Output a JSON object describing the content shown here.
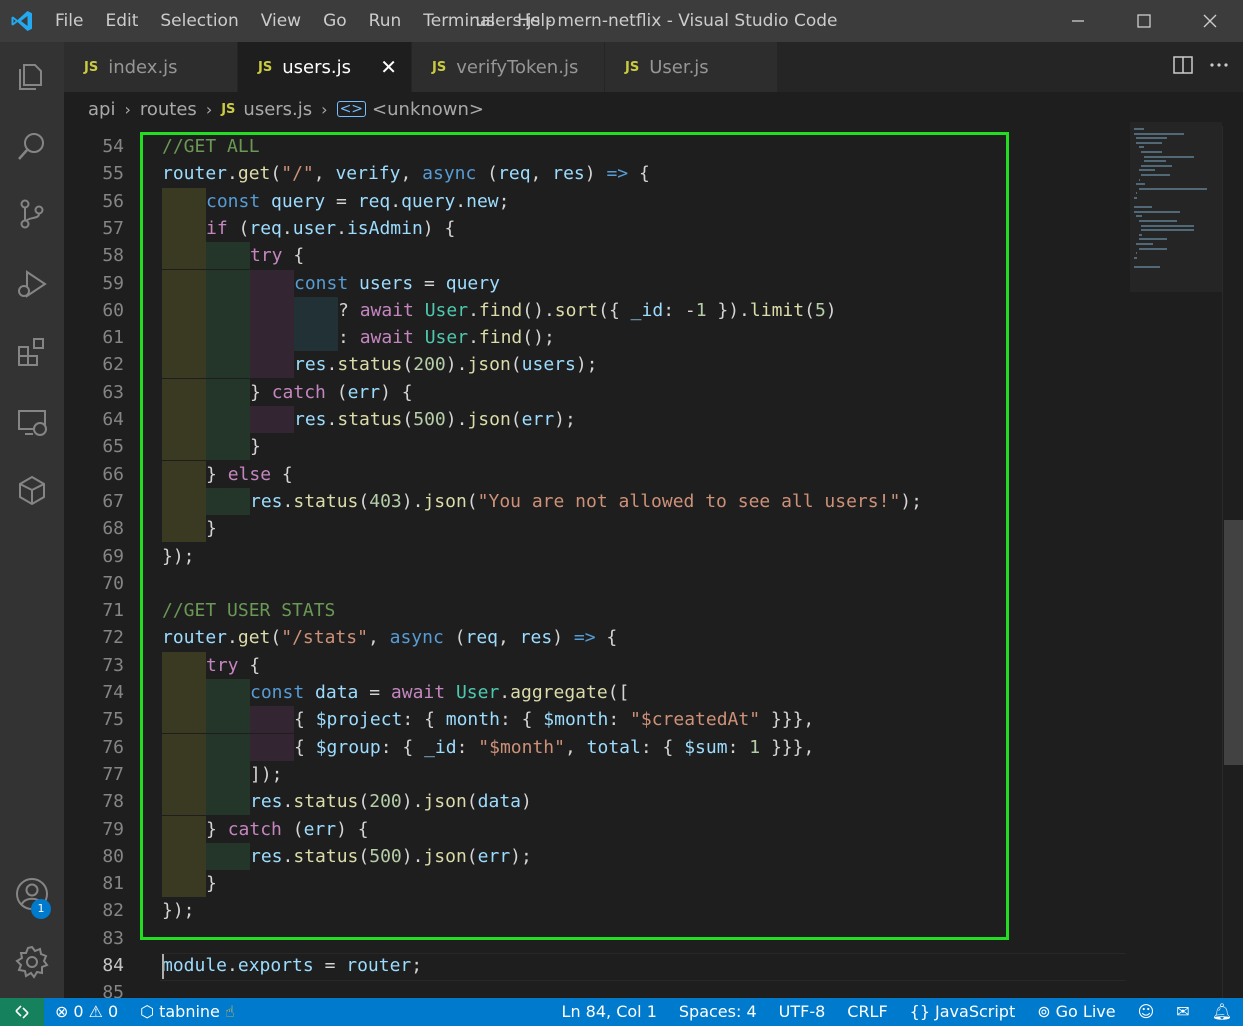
{
  "window": {
    "title": "users.js - mern-netflix - Visual Studio Code",
    "menu": [
      "File",
      "Edit",
      "Selection",
      "View",
      "Go",
      "Run",
      "Terminal",
      "Help"
    ]
  },
  "tabs": [
    {
      "icon": "JS",
      "label": "index.js",
      "active": false
    },
    {
      "icon": "JS",
      "label": "users.js",
      "active": true
    },
    {
      "icon": "JS",
      "label": "verifyToken.js",
      "active": false
    },
    {
      "icon": "JS",
      "label": "User.js",
      "active": false
    }
  ],
  "breadcrumb": {
    "folder1": "api",
    "folder2": "routes",
    "file_icon": "JS",
    "file": "users.js",
    "symbol": "<unknown>"
  },
  "activity": {
    "accounts_badge": "1"
  },
  "editor": {
    "line_numbers": [
      "54",
      "55",
      "56",
      "57",
      "58",
      "59",
      "60",
      "61",
      "62",
      "63",
      "64",
      "65",
      "66",
      "67",
      "68",
      "69",
      "70",
      "71",
      "72",
      "73",
      "74",
      "75",
      "76",
      "77",
      "78",
      "79",
      "80",
      "81",
      "82",
      "83",
      "84",
      "85"
    ],
    "current_line": "84",
    "lines": [
      "//GET ALL",
      "router.get(\"/\", verify, async (req, res) => {",
      "  const query = req.query.new;",
      "  if (req.user.isAdmin) {",
      "    try {",
      "      const users = query",
      "        ? await User.find().sort({ _id: -1 }).limit(5)",
      "        : await User.find();",
      "      res.status(200).json(users);",
      "    } catch (err) {",
      "      res.status(500).json(err);",
      "    }",
      "  } else {",
      "    res.status(403).json(\"You are not allowed to see all users!\");",
      "  }",
      "});",
      "",
      "//GET USER STATS",
      "router.get(\"/stats\", async (req, res) => {",
      "  try {",
      "    const data = await User.aggregate([",
      "      { $project: { month: { $month: \"$createdAt\" }}},",
      "      { $group: { _id: \"$month\", total: { $sum: 1 }}},",
      "    ]);",
      "    res.status(200).json(data)",
      "  } catch (err) {",
      "    res.status(500).json(err);",
      "  }",
      "});",
      "",
      "module.exports = router;",
      ""
    ]
  },
  "statusbar": {
    "errors": "0",
    "warnings": "0",
    "tabnine": "tabnine",
    "position": "Ln 84, Col 1",
    "spaces": "Spaces: 4",
    "encoding": "UTF-8",
    "eol": "CRLF",
    "language_icon": "{}",
    "language": "JavaScript",
    "golive": "Go Live"
  },
  "colors": {
    "highlight_border": "#22dd22",
    "statusbar": "#007acc",
    "titlebar": "#3c3c3c",
    "activitybar": "#333333"
  }
}
